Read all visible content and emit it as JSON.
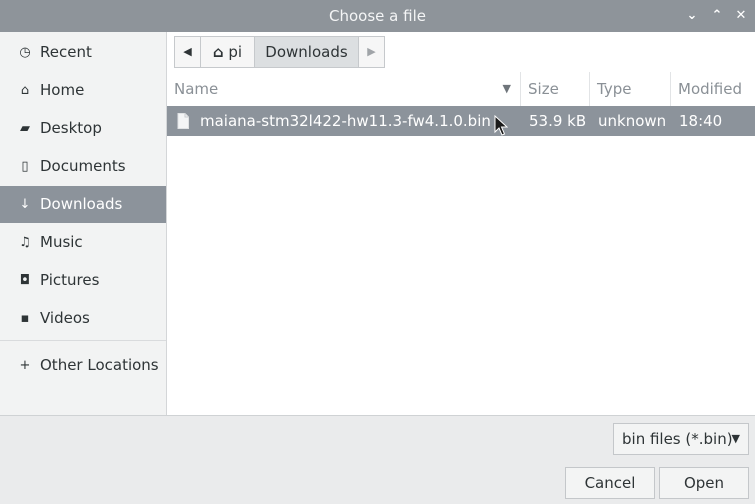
{
  "window": {
    "title": "Choose a file"
  },
  "titlebar_buttons": {
    "minimize": "⌄",
    "maximize": "⌃",
    "close": "✕"
  },
  "sidebar": {
    "items": [
      {
        "icon": "clock-icon",
        "glyph": "◷",
        "label": "Recent"
      },
      {
        "icon": "home-icon",
        "glyph": "⌂",
        "label": "Home"
      },
      {
        "icon": "folder-icon",
        "glyph": "▰",
        "label": "Desktop"
      },
      {
        "icon": "document-icon",
        "glyph": "▯",
        "label": "Documents"
      },
      {
        "icon": "download-icon",
        "glyph": "↓",
        "label": "Downloads",
        "active": true
      },
      {
        "icon": "music-icon",
        "glyph": "♫",
        "label": "Music"
      },
      {
        "icon": "camera-icon",
        "glyph": "◘",
        "label": "Pictures"
      },
      {
        "icon": "video-icon",
        "glyph": "▪",
        "label": "Videos"
      },
      {
        "icon": "plus-icon",
        "glyph": "+",
        "label": "Other Locations"
      }
    ]
  },
  "pathbar": {
    "back_glyph": "◀",
    "home_glyph": "⌂",
    "home_label": "pi",
    "current": "Downloads",
    "forward_glyph": "▶"
  },
  "columns": {
    "name": "Name",
    "sort_glyph": "▼",
    "size": "Size",
    "type": "Type",
    "modified": "Modified"
  },
  "files": [
    {
      "name": "maiana-stm32l422-hw11.3-fw4.1.0.bin",
      "size": "53.9 kB",
      "type": "unknown",
      "modified": "18:40"
    }
  ],
  "filter": {
    "value": "bin files (*.bin)",
    "arrow": "▼"
  },
  "actions": {
    "cancel": "Cancel",
    "open": "Open"
  },
  "colors": {
    "titlebar": "#8e949a",
    "selection": "#8c939b",
    "sidebar": "#f2f3f3"
  }
}
